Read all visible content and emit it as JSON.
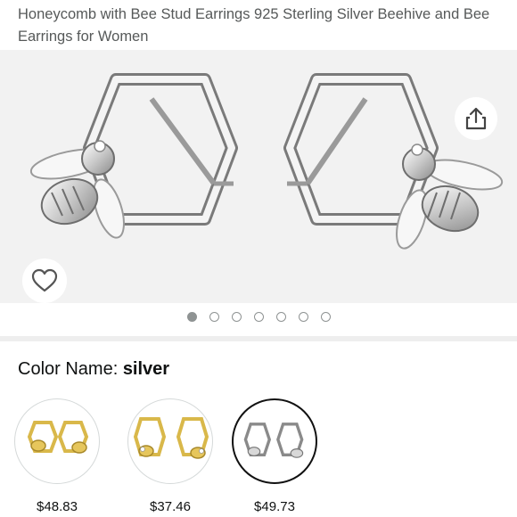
{
  "product": {
    "title": "Honeycomb with Bee Stud Earrings 925 Sterling Silver Beehive and Bee Earrings for Women"
  },
  "gallery": {
    "image_count": 7,
    "active_index": 0,
    "share_icon": "share-icon",
    "wishlist_icon": "heart-outline-icon"
  },
  "color": {
    "label": "Color Name: ",
    "selected": "silver"
  },
  "variants": [
    {
      "price": "$48.83",
      "finish": "gold",
      "selected": false
    },
    {
      "price": "$37.46",
      "finish": "gold-crystal",
      "selected": false
    },
    {
      "price": "$49.73",
      "finish": "silver",
      "selected": true
    }
  ],
  "colors": {
    "background": "#ffffff",
    "gallery_bg": "#f2f2f2",
    "title_text": "#565959",
    "dot": "#8f9393",
    "selected_border": "#111111",
    "gold": "#d9b84a"
  }
}
